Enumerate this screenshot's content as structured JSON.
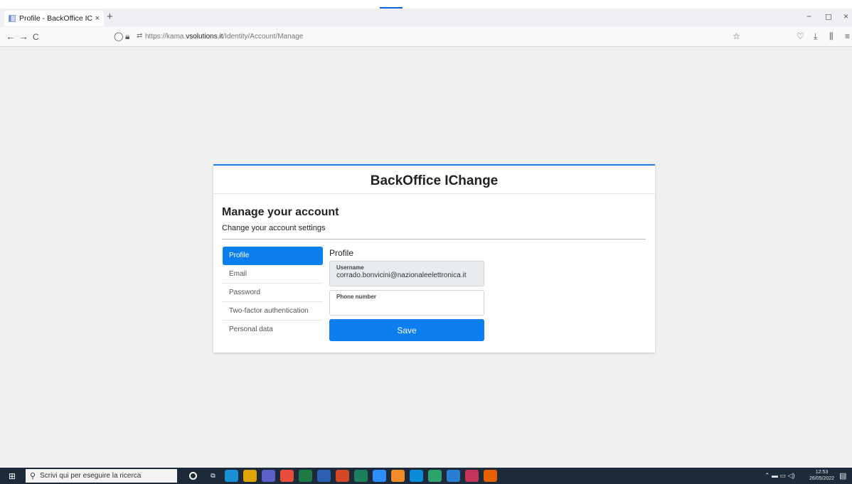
{
  "browser": {
    "tab_title": "Profile - BackOffice IChange",
    "tab_close": "×",
    "new_tab": "+",
    "url_prefix": "https://kama.",
    "url_domain": "vsolutions.it",
    "url_path": "/Identity/Account/Manage",
    "back": "←",
    "forward": "→",
    "reload": "C",
    "minimize": "−",
    "restore": "◻",
    "close": "×"
  },
  "card": {
    "brand": "BackOffice IChange",
    "heading": "Manage your account",
    "subheading": "Change your account settings"
  },
  "menu": {
    "items": [
      {
        "label": "Profile",
        "active": true
      },
      {
        "label": "Email",
        "active": false
      },
      {
        "label": "Password",
        "active": false
      },
      {
        "label": "Two-factor authentication",
        "active": false
      },
      {
        "label": "Personal data",
        "active": false
      }
    ]
  },
  "profile": {
    "title": "Profile",
    "username_label": "Username",
    "username_value": "corrado.bonvicini@nazionaleelettronica.it",
    "phone_label": "Phone number",
    "phone_value": "",
    "save_label": "Save"
  },
  "taskbar": {
    "search_placeholder": "Scrivi qui per eseguire la ricerca",
    "time": "12:53",
    "date": "26/05/2022"
  },
  "colors": {
    "accent": "#0d7ef0",
    "card_border": "#1e7ee8",
    "taskbar": "#1c2a3a"
  }
}
